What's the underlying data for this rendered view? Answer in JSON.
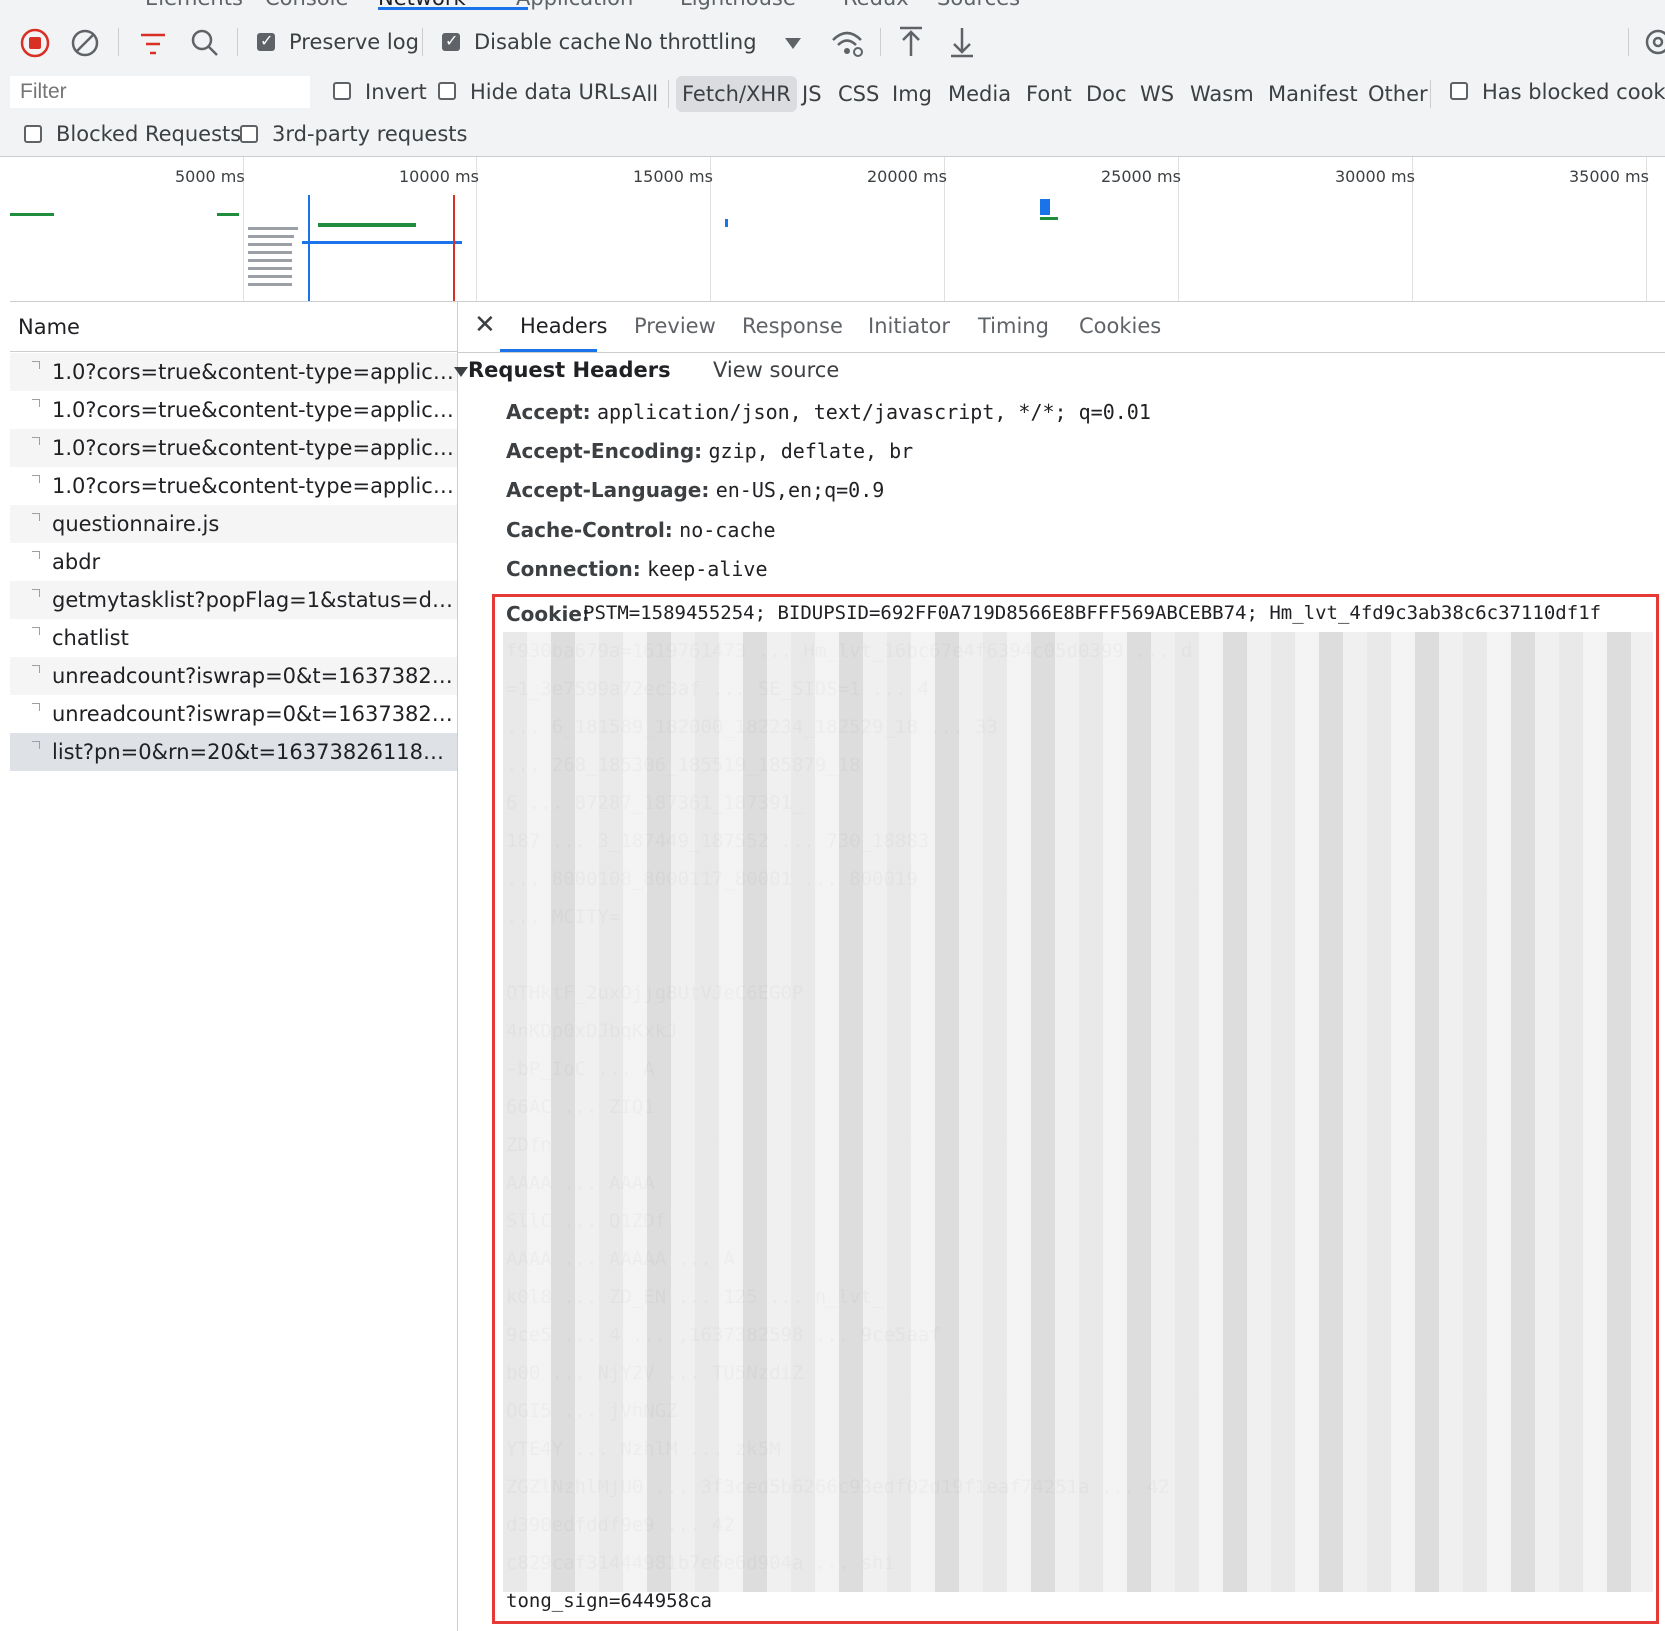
{
  "devtools_tabs": [
    "Elements",
    "Console",
    "Network",
    "Application",
    "Lighthouse",
    "Redux",
    "Sources"
  ],
  "toolbar": {
    "preserve_log_label": "Preserve log",
    "disable_cache_label": "Disable cache",
    "throttling_value": "No throttling",
    "icons": [
      "record-stop-icon",
      "clear-icon",
      "filter-icon",
      "search-icon",
      "wifi-settings-icon",
      "upload-icon",
      "download-icon",
      "gear-icon"
    ]
  },
  "filter": {
    "placeholder": "Filter",
    "invert_label": "Invert",
    "hide_data_urls_label": "Hide data URLs",
    "types": [
      "All",
      "Fetch/XHR",
      "JS",
      "CSS",
      "Img",
      "Media",
      "Font",
      "Doc",
      "WS",
      "Wasm",
      "Manifest",
      "Other"
    ],
    "active_type": "Fetch/XHR",
    "has_blocked_cookies_label": "Has blocked cookie",
    "blocked_requests_label": "Blocked Requests",
    "third_party_label": "3rd-party requests"
  },
  "overview": {
    "ticks": [
      "5000 ms",
      "10000 ms",
      "15000 ms",
      "20000 ms",
      "25000 ms",
      "30000 ms",
      "35000 ms"
    ]
  },
  "request_list": {
    "header": "Name",
    "rows": [
      "1.0?cors=true&content-type=applicatio...",
      "1.0?cors=true&content-type=applicatio...",
      "1.0?cors=true&content-type=applicatio...",
      "1.0?cors=true&content-type=applicatio...",
      "questionnaire.js",
      "abdr",
      "getmytasklist?popFlag=1&status=done...",
      "chatlist",
      "unreadcount?iswrap=0&t=1637382596...",
      "unreadcount?iswrap=0&t=1637382611...",
      "list?pn=0&rn=20&t=1637382611831&t..."
    ]
  },
  "detail": {
    "tabs": [
      "Headers",
      "Preview",
      "Response",
      "Initiator",
      "Timing",
      "Cookies"
    ],
    "active_tab": "Headers",
    "section_title": "Request Headers",
    "view_source": "View source",
    "headers": [
      {
        "k": "Accept:",
        "v": "application/json, text/javascript, */*; q=0.01"
      },
      {
        "k": "Accept-Encoding:",
        "v": "gzip, deflate, br"
      },
      {
        "k": "Accept-Language:",
        "v": "en-US,en;q=0.9"
      },
      {
        "k": "Cache-Control:",
        "v": "no-cache"
      },
      {
        "k": "Connection:",
        "v": "keep-alive"
      }
    ],
    "cookie_key": "Cookie:",
    "cookie_lines": [
      "PSTM=1589455254; BIDUPSID=692FF0A719D8566E8BFFF569ABCEBB74; Hm_lvt_4fd9c3ab38c6c37110df1f",
      "f930ba679a=1619761473 ... Hm_lvt_16bc67e4f6394c05d0399 ... d",
      "=1_3e7599a72ec3af ... SE_SIDS=1 ... 4",
      " ... 6_181589_182000_182234_182529_18 ... 33",
      " ... 268_185306_185519_185879_18",
      "6 ... 87287_187361_187391_",
      "187 ... 3_187449_187552 ... 730_18883",
      " ... 8000108_8000117_80001 ... 800019",
      " ... MCITY=",
      "",
      "OTHktF_2uxOjjg8UtVJeC6EG0P",
      "4nKDp0xDJbqKxkJ",
      "-bP_IoC ... A",
      "66AC ... ZIQ1",
      "ZDfn",
      "AAAA ... AAAA",
      "SllC ... Q1ZDf",
      "AAAA ... AAAAA ... A",
      "k0l8 ... ZD_EN ... 125 ... n_lvt_",
      "9ce5 ... 4 ... ,1637382598 ... 9ce5aaf",
      "b00 ... NjY2V ... TU5NzdiZ",
      "OGI5 ... jVhNGZ",
      "YTE4Y ... NzhlM ... zk5M",
      "ZGZlNzhlMjU0 ... 3f3ced5b6266c93edf02d19f1eaf74251a ... 42",
      "d390edfddf9e9 ... 42",
      "c829caf31444981b7e6e6d904a ... shi",
      "tong_sign=644958ca"
    ]
  },
  "colors": {
    "accent": "#1a73e8",
    "record_red": "#d93025",
    "highlight_box": "#e53935"
  }
}
